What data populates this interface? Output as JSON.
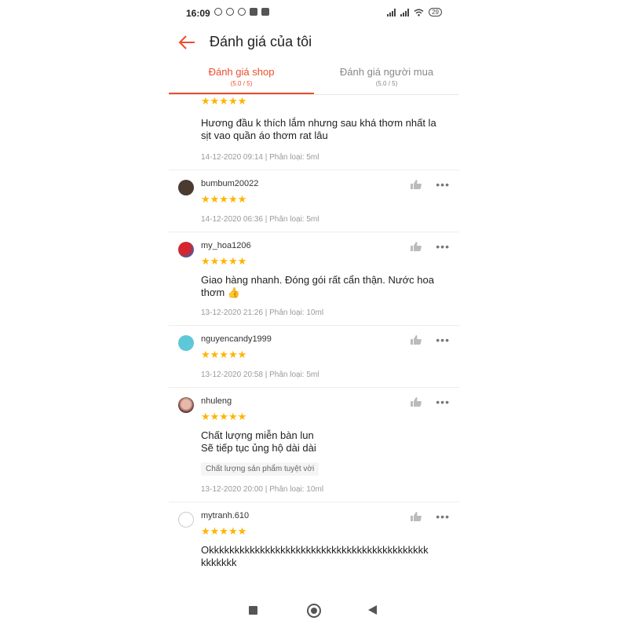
{
  "status_bar": {
    "time": "16:09",
    "battery": "29"
  },
  "header": {
    "title": "Đánh giá của tôi",
    "back_icon": "arrow-left-icon"
  },
  "tabs": [
    {
      "label": "Đánh giá shop",
      "sub": "(5.0 / 5)",
      "active": true
    },
    {
      "label": "Đánh giá người mua",
      "sub": "(5.0 / 5)",
      "active": false
    }
  ],
  "colors": {
    "accent": "#ee4d2d",
    "star": "#ffb400"
  },
  "reviews": [
    {
      "stars": "★★★★★",
      "comment": "Hương đầu k thích lắm nhưng sau khá thơm nhất la\nsịt vao quần áo thơm rat lâu",
      "meta": "14-12-2020 09:14 | Phân loại: 5ml"
    },
    {
      "username": "bumbum20022",
      "stars": "★★★★★",
      "meta": "14-12-2020 06:36 | Phân loại: 5ml"
    },
    {
      "username": "my_hoa1206",
      "stars": "★★★★★",
      "comment": "Giao hàng nhanh. Đóng gói rất cẩn thận. Nước hoa\nthơm 👍",
      "meta": "13-12-2020 21:26 | Phân loại: 10ml"
    },
    {
      "username": "nguyencandy1999",
      "stars": "★★★★★",
      "meta": "13-12-2020 20:58 | Phân loại: 5ml"
    },
    {
      "username": "nhuleng",
      "stars": "★★★★★",
      "comment": "Chất lượng miễn bàn lun\nSẽ tiếp tục ủng hộ dài dài",
      "tag": "Chất lượng sản phẩm tuyệt vời",
      "meta": "13-12-2020 20:00 | Phân loại: 10ml"
    },
    {
      "username": "mytranh.610",
      "stars": "★★★★★",
      "comment": "Okkkkkkkkkkkkkkkkkkkkkkkkkkkkkkkkkkkkkkkkkkk\nkkkkkkk"
    }
  ],
  "icons": {
    "like": "thumbs-up-icon",
    "more": "more-dots-icon"
  },
  "more_label": "•••",
  "navbar": [
    "recent-apps-icon",
    "home-icon",
    "back-icon"
  ]
}
